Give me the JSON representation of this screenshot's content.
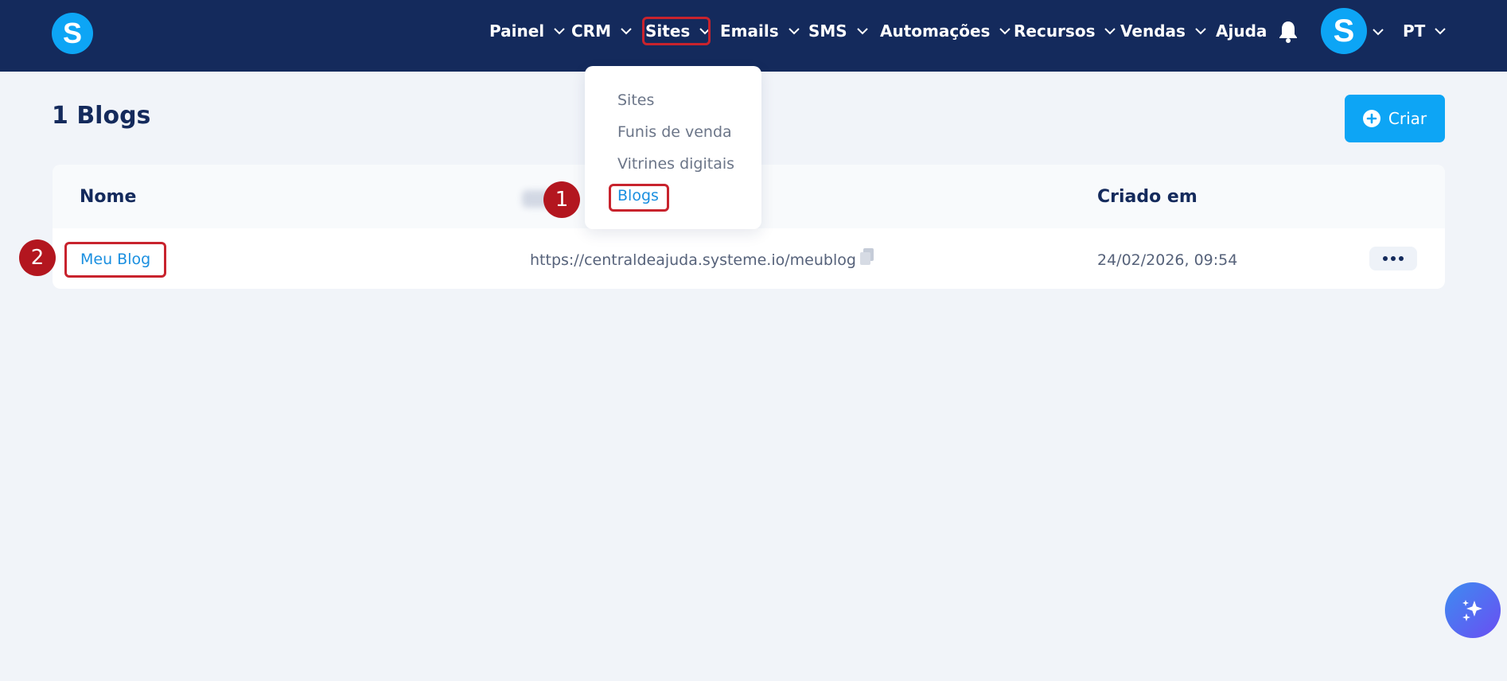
{
  "app": {
    "logo_letter": "S",
    "avatar_letter": "S"
  },
  "nav": {
    "items": [
      {
        "label": "Painel",
        "has_chevron": true
      },
      {
        "label": "CRM",
        "has_chevron": true
      },
      {
        "label": "Sites",
        "has_chevron": true
      },
      {
        "label": "Emails",
        "has_chevron": true
      },
      {
        "label": "SMS",
        "has_chevron": true
      },
      {
        "label": "Automações",
        "has_chevron": true
      },
      {
        "label": "Recursos",
        "has_chevron": true
      },
      {
        "label": "Vendas",
        "has_chevron": true
      },
      {
        "label": "Ajuda",
        "has_chevron": false
      }
    ],
    "language": "PT",
    "icons": {
      "notifications": "bell-icon"
    }
  },
  "dropdown": {
    "items": [
      "Sites",
      "Funis de venda",
      "Vitrines digitais",
      "Blogs"
    ],
    "active": "Blogs"
  },
  "page": {
    "title": "1 Blogs",
    "create_label": "Criar"
  },
  "table": {
    "headers": {
      "name": "Nome",
      "created": "Criado em"
    },
    "rows": [
      {
        "name": "Meu Blog",
        "url": "https://centraldeajuda.systeme.io/meublog",
        "created": "24/02/2026, 09:54"
      }
    ]
  },
  "annotations": {
    "step1": "1",
    "step2": "2"
  },
  "colors": {
    "nav_bg": "#142a5c",
    "accent": "#0da5f5",
    "link": "#1a8fe0",
    "highlight": "#c8232d"
  }
}
